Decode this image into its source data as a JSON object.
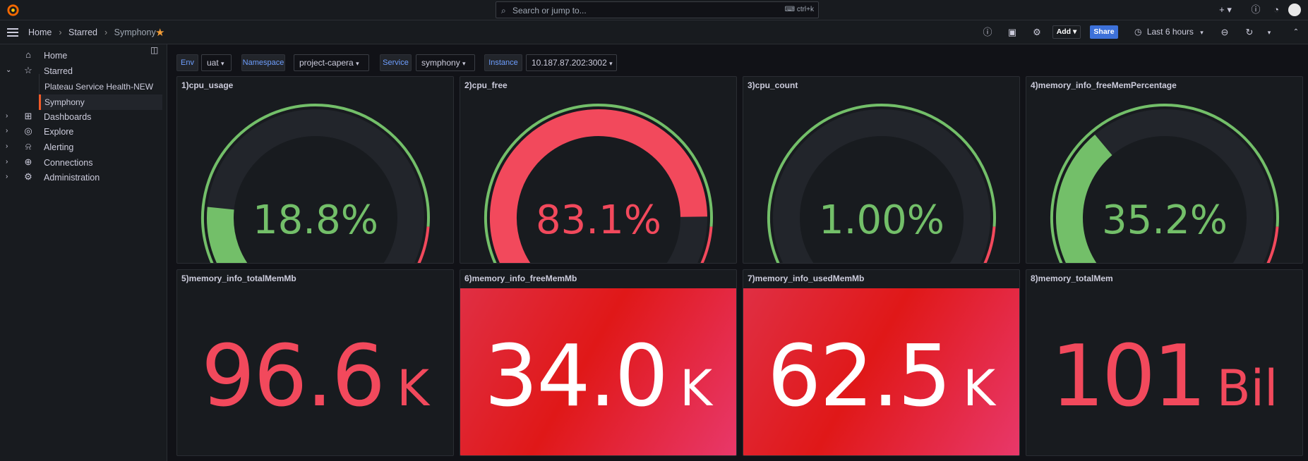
{
  "topbar": {
    "search_placeholder": "Search or jump to...",
    "search_shortcut": "ctrl+k"
  },
  "navbar": {
    "breadcrumbs": [
      "Home",
      "Starred",
      "Symphony"
    ],
    "add_label": "Add",
    "share_label": "Share",
    "time_range": "Last 6 hours"
  },
  "sidebar": {
    "items": [
      {
        "label": "Home",
        "icon": "home-icon"
      },
      {
        "label": "Starred",
        "icon": "star-icon"
      },
      {
        "label": "Dashboards",
        "icon": "dashboards-icon"
      },
      {
        "label": "Explore",
        "icon": "compass-icon"
      },
      {
        "label": "Alerting",
        "icon": "bell-icon"
      },
      {
        "label": "Connections",
        "icon": "plug-icon"
      },
      {
        "label": "Administration",
        "icon": "gear-icon"
      }
    ],
    "starred_children": [
      "Plateau Service Health-NEW",
      "Symphony"
    ]
  },
  "variables": [
    {
      "label": "Env",
      "value": "uat"
    },
    {
      "label": "Namespace",
      "value": "project-capera"
    },
    {
      "label": "Service",
      "value": "symphony"
    },
    {
      "label": "Instance",
      "value": "10.187.87.202:3002"
    }
  ],
  "colors": {
    "green": "#73bf69",
    "red": "#f2495c",
    "track": "#22252b",
    "accent": "#3d71d9",
    "stat_red": "#e02f44"
  },
  "gauges": [
    {
      "title": "1)cpu_usage",
      "display": "18.8%",
      "percent": 18.8,
      "color": "#73bf69"
    },
    {
      "title": "2)cpu_free",
      "display": "83.1%",
      "percent": 83.1,
      "color": "#f2495c"
    },
    {
      "title": "3)cpu_count",
      "display": "1.00%",
      "percent": 1.0,
      "color": "#73bf69"
    },
    {
      "title": "4)memory_info_freeMemPercentage",
      "display": "35.2%",
      "percent": 35.2,
      "color": "#73bf69"
    }
  ],
  "stats": [
    {
      "title": "5)memory_info_totalMemMb",
      "value": "96.6",
      "unit": "K",
      "mode": "text"
    },
    {
      "title": "6)memory_info_freeMemMb",
      "value": "34.0",
      "unit": "K",
      "mode": "background"
    },
    {
      "title": "7)memory_info_usedMemMb",
      "value": "62.5",
      "unit": "K",
      "mode": "background"
    },
    {
      "title": "8)memory_totalMem",
      "value": "101",
      "unit": "Bil",
      "mode": "text"
    }
  ]
}
